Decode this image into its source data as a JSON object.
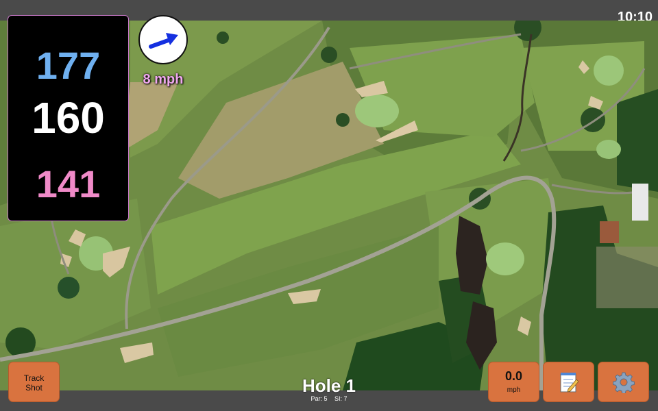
{
  "clock": {
    "time": "10:10"
  },
  "distances": {
    "back": "177",
    "center": "160",
    "front": "141"
  },
  "wind": {
    "speed_label": "8 mph",
    "icon": "wind-direction-arrow-icon"
  },
  "buttons": {
    "track_shot_line1": "Track",
    "track_shot_line2": "Shot",
    "speed_value": "0.0",
    "speed_unit": "mph",
    "notes_icon": "notepad-icon",
    "settings_icon": "gear-icon"
  },
  "hole": {
    "title": "Hole 1",
    "par": "Par: 5",
    "si": "SI: 7"
  },
  "colors": {
    "back": "#6fb0f0",
    "center": "#ffffff",
    "front": "#f08ac8",
    "button": "#d9733f",
    "wind_label": "#f0a8f0"
  }
}
